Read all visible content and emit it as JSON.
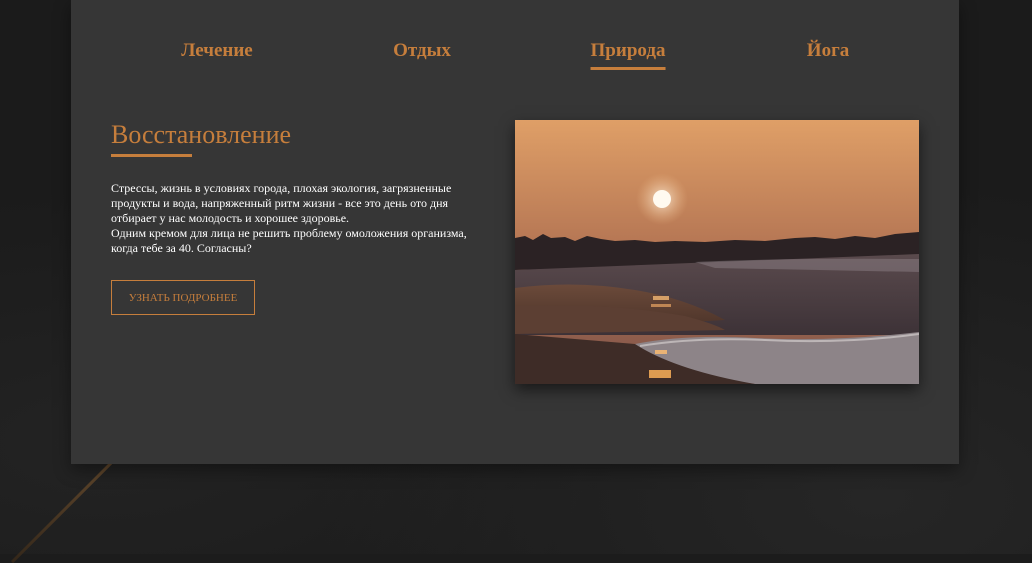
{
  "nav": {
    "tabs": [
      {
        "label": "Лечение",
        "active": false
      },
      {
        "label": "Отдых",
        "active": false
      },
      {
        "label": "Природа",
        "active": true
      },
      {
        "label": "Йога",
        "active": false
      }
    ]
  },
  "section": {
    "title": "Восстановление",
    "paragraph_1": "Стрессы, жизнь в условиях города, плохая экология, загрязненные продукты и вода, напряженный ритм жизни - все это день ото дня отбирает у нас молодость и хорошее здоровье.",
    "paragraph_2": "Одним кремом для лица не решить проблему омоложения организма, когда тебе за 40. Согласны?",
    "button_label": "Узнать подробнее"
  },
  "image": {
    "subject": "sunset-over-beach-photo"
  },
  "colors": {
    "accent": "#c67e3c",
    "panel": "#363636",
    "background": "#1b1b1b",
    "text": "#ffffff"
  }
}
